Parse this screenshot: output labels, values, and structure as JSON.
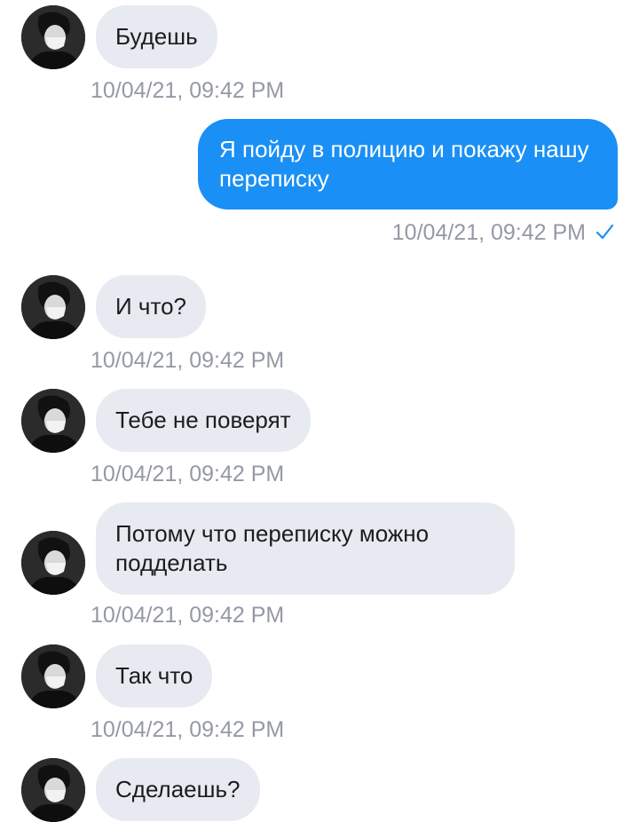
{
  "colors": {
    "received_bubble": "#e8eaf2",
    "sent_bubble": "#1a8ff5",
    "timestamp": "#9599a6",
    "read_check": "#1a8ff5"
  },
  "messages": [
    {
      "direction": "received",
      "text": "Будешь",
      "time": "10/04/21, 09:42 PM",
      "avatar": "user-avatar"
    },
    {
      "direction": "sent",
      "text": "Я пойду в полицию и покажу нашу переписку",
      "time": "10/04/21, 09:42 PM",
      "status_icon": "read-check-icon"
    },
    {
      "direction": "received",
      "text": "И что?",
      "time": "10/04/21, 09:42 PM",
      "avatar": "user-avatar"
    },
    {
      "direction": "received",
      "text": "Тебе не поверят",
      "time": "10/04/21, 09:42 PM",
      "avatar": "user-avatar"
    },
    {
      "direction": "received",
      "text": "Потому что переписку можно подделать",
      "time": "10/04/21, 09:42 PM",
      "avatar": "user-avatar"
    },
    {
      "direction": "received",
      "text": "Так что",
      "time": "10/04/21, 09:42 PM",
      "avatar": "user-avatar"
    },
    {
      "direction": "received",
      "text": "Сделаешь?",
      "avatar": "user-avatar"
    }
  ]
}
